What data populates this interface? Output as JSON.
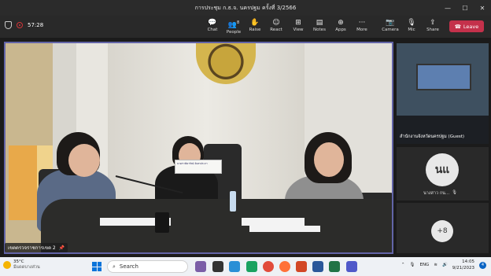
{
  "window": {
    "title": "การประชุม ก.ธ.จ. นครปฐม ครั้งที่ 3/2566",
    "controls": [
      "—",
      "☐",
      "✕"
    ]
  },
  "call": {
    "timer": "57:28"
  },
  "toolbar": {
    "buttons": [
      {
        "label": "Chat",
        "icon": "💬"
      },
      {
        "label": "People",
        "icon": "👥",
        "count": "8"
      },
      {
        "label": "Raise",
        "icon": "✋"
      },
      {
        "label": "React",
        "icon": "☺"
      },
      {
        "label": "View",
        "icon": "⊞"
      },
      {
        "label": "Notes",
        "icon": "▤"
      },
      {
        "label": "Apps",
        "icon": "⊕"
      },
      {
        "label": "More",
        "icon": "···"
      },
      {
        "label": "Camera",
        "icon": "📷"
      },
      {
        "label": "Mic",
        "icon": "🎙"
      },
      {
        "label": "Share",
        "icon": "⇪"
      }
    ],
    "leave_label": "Leave"
  },
  "main_video": {
    "name": "เขตตรวจราชการเขต 2",
    "pin_icon": "📌",
    "namecard_text": "นางสาวธิดารัตน์ จันทรประภา"
  },
  "side_videos": [
    {
      "name": "สำนักงานจังหวัดนครปฐม (Guest)"
    },
    {
      "name": "นางสาว กน...",
      "initials": "นแ"
    }
  ],
  "overflow_count": "+8",
  "taskbar": {
    "weather_temp": "35°C",
    "weather_desc": "มีแดดบางส่วน",
    "search_placeholder": "Search",
    "language": "ENG",
    "time": "14:05",
    "date": "9/21/2023",
    "notifications": "4"
  },
  "colors": {
    "accent": "#6264a7",
    "leave": "#c4314b",
    "titlebar": "#2b2b2b"
  }
}
